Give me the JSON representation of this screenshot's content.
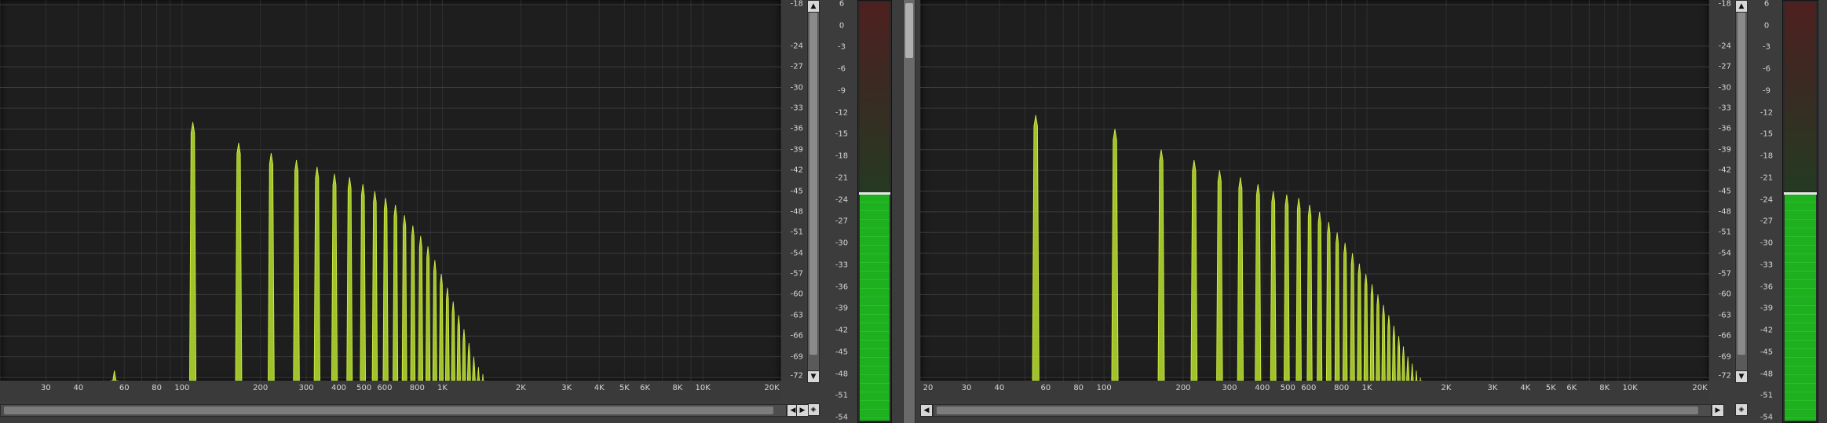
{
  "colors": {
    "plot_bg": "#1e1e1e",
    "grid_minor": "#2f2f2f",
    "grid_major": "#3b3b3b",
    "spectrum": "#b7e02f",
    "meter_green": "#22b822"
  },
  "icons": {
    "up": "up-arrow-icon",
    "down": "down-arrow-icon",
    "left": "left-arrow-icon",
    "right": "right-arrow-icon",
    "zoom": "zoom-icon"
  },
  "analyzers": [
    {
      "freq_labels": [
        "30",
        "40",
        "60",
        "80",
        "100",
        "200",
        "300",
        "400",
        "500",
        "600",
        "800",
        "1K",
        "2K",
        "3K",
        "4K",
        "5K",
        "6K",
        "8K",
        "10K",
        "20K"
      ],
      "db_labels": [
        "-18",
        "-24",
        "-27",
        "-30",
        "-33",
        "-36",
        "-39",
        "-42",
        "-45",
        "-48",
        "-51",
        "-54",
        "-57",
        "-60",
        "-63",
        "-66",
        "-69",
        "-72"
      ],
      "meter_labels": [
        "6",
        "0",
        "-3",
        "-6",
        "-9",
        "-12",
        "-15",
        "-18",
        "-21",
        "-24",
        "-27",
        "-30",
        "-33",
        "-36",
        "-39",
        "-42",
        "-45",
        "-48",
        "-51",
        "-54"
      ],
      "meter_level_db": -21.5,
      "chart_data": {
        "type": "bar",
        "x_scale": "log",
        "xlim": [
          20,
          20000
        ],
        "ylim": [
          -72,
          -18
        ],
        "y_unit": "dB",
        "points": [
          {
            "hz": 55,
            "db": -71
          },
          {
            "hz": 110,
            "db": -35
          },
          {
            "hz": 165,
            "db": -38
          },
          {
            "hz": 220,
            "db": -39.5
          },
          {
            "hz": 275,
            "db": -40.5
          },
          {
            "hz": 330,
            "db": -41.5
          },
          {
            "hz": 385,
            "db": -42.5
          },
          {
            "hz": 440,
            "db": -43
          },
          {
            "hz": 495,
            "db": -44
          },
          {
            "hz": 550,
            "db": -45
          },
          {
            "hz": 605,
            "db": -46
          },
          {
            "hz": 660,
            "db": -47
          },
          {
            "hz": 715,
            "db": -48.5
          },
          {
            "hz": 770,
            "db": -50
          },
          {
            "hz": 825,
            "db": -51.5
          },
          {
            "hz": 880,
            "db": -53
          },
          {
            "hz": 935,
            "db": -55
          },
          {
            "hz": 990,
            "db": -57
          },
          {
            "hz": 1045,
            "db": -59
          },
          {
            "hz": 1100,
            "db": -61
          },
          {
            "hz": 1155,
            "db": -63
          },
          {
            "hz": 1210,
            "db": -65
          },
          {
            "hz": 1265,
            "db": -67
          },
          {
            "hz": 1320,
            "db": -69
          },
          {
            "hz": 1375,
            "db": -70.5
          },
          {
            "hz": 1430,
            "db": -71.5
          }
        ]
      }
    },
    {
      "freq_labels": [
        "20",
        "30",
        "40",
        "60",
        "80",
        "100",
        "200",
        "300",
        "400",
        "500",
        "600",
        "800",
        "1K",
        "2K",
        "3K",
        "4K",
        "5K",
        "6K",
        "8K",
        "10K",
        "20K"
      ],
      "db_labels": [
        "-18",
        "-24",
        "-27",
        "-30",
        "-33",
        "-36",
        "-39",
        "-42",
        "-45",
        "-48",
        "-51",
        "-54",
        "-57",
        "-60",
        "-63",
        "-66",
        "-69",
        "-72"
      ],
      "meter_labels": [
        "6",
        "0",
        "-3",
        "-6",
        "-9",
        "-12",
        "-15",
        "-18",
        "-21",
        "-24",
        "-27",
        "-30",
        "-33",
        "-36",
        "-39",
        "-42",
        "-45",
        "-48",
        "-51",
        "-54"
      ],
      "meter_level_db": -21.5,
      "chart_data": {
        "type": "bar",
        "x_scale": "log",
        "xlim": [
          20,
          20000
        ],
        "ylim": [
          -72,
          -18
        ],
        "y_unit": "dB",
        "points": [
          {
            "hz": 55,
            "db": -34
          },
          {
            "hz": 110,
            "db": -36
          },
          {
            "hz": 165,
            "db": -39
          },
          {
            "hz": 220,
            "db": -40.5
          },
          {
            "hz": 275,
            "db": -42
          },
          {
            "hz": 330,
            "db": -43
          },
          {
            "hz": 385,
            "db": -44
          },
          {
            "hz": 440,
            "db": -45
          },
          {
            "hz": 495,
            "db": -45.5
          },
          {
            "hz": 550,
            "db": -46
          },
          {
            "hz": 605,
            "db": -47
          },
          {
            "hz": 660,
            "db": -48
          },
          {
            "hz": 715,
            "db": -49.5
          },
          {
            "hz": 770,
            "db": -51
          },
          {
            "hz": 825,
            "db": -52.5
          },
          {
            "hz": 880,
            "db": -54
          },
          {
            "hz": 935,
            "db": -55.5
          },
          {
            "hz": 990,
            "db": -57
          },
          {
            "hz": 1045,
            "db": -58.5
          },
          {
            "hz": 1100,
            "db": -60
          },
          {
            "hz": 1155,
            "db": -61.5
          },
          {
            "hz": 1210,
            "db": -63
          },
          {
            "hz": 1265,
            "db": -64.5
          },
          {
            "hz": 1320,
            "db": -66
          },
          {
            "hz": 1375,
            "db": -67.5
          },
          {
            "hz": 1430,
            "db": -69
          },
          {
            "hz": 1485,
            "db": -70
          },
          {
            "hz": 1540,
            "db": -71
          },
          {
            "hz": 1595,
            "db": -72
          }
        ]
      }
    }
  ]
}
